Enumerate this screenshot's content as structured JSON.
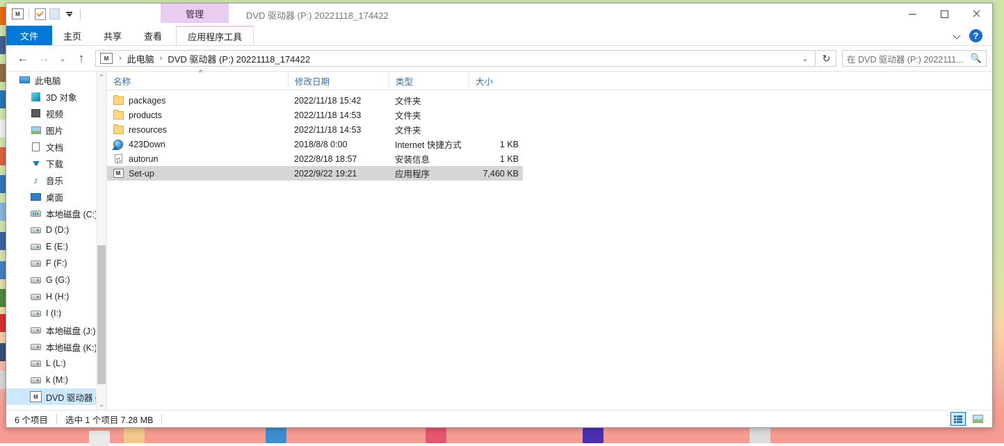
{
  "window": {
    "title": "DVD 驱动器 (P:) 20221118_174422",
    "contextual_tab_group": "管理",
    "controls": {
      "minimize": "minimize",
      "maximize": "maximize",
      "close": "close"
    }
  },
  "quick_access": {
    "items": [
      {
        "name": "app-icon",
        "glyph": "M"
      },
      {
        "name": "properties-icon",
        "glyph": ""
      },
      {
        "name": "new-folder-icon",
        "glyph": ""
      },
      {
        "name": "customize-qat-icon",
        "glyph": ""
      }
    ]
  },
  "ribbon": {
    "tabs": [
      {
        "id": "file",
        "label": "文件"
      },
      {
        "id": "home",
        "label": "主页"
      },
      {
        "id": "share",
        "label": "共享"
      },
      {
        "id": "view",
        "label": "查看"
      },
      {
        "id": "app-tools",
        "label": "应用程序工具"
      }
    ],
    "collapse_icon": "chevron-down-icon",
    "help_label": "?"
  },
  "address": {
    "back": "←",
    "forward": "→",
    "recent": "⌄",
    "up": "↑",
    "crumb_icon": "M",
    "crumbs": [
      "此电脑",
      "DVD 驱动器 (P:) 20221118_174422"
    ],
    "separator": "›",
    "dropdown": "⌄",
    "refresh": "↻"
  },
  "search": {
    "placeholder": "在 DVD 驱动器 (P:) 2022111...",
    "icon": "search-icon"
  },
  "sidebar": {
    "items": [
      {
        "label": "此电脑",
        "icon": "pc-icon",
        "level": "root",
        "selected": false
      },
      {
        "label": "3D 对象",
        "icon": "3d-icon",
        "level": "indent",
        "selected": false
      },
      {
        "label": "视频",
        "icon": "video-icon",
        "level": "indent",
        "selected": false
      },
      {
        "label": "图片",
        "icon": "picture-icon",
        "level": "indent",
        "selected": false
      },
      {
        "label": "文档",
        "icon": "document-icon",
        "level": "indent",
        "selected": false
      },
      {
        "label": "下载",
        "icon": "download-icon",
        "level": "indent",
        "selected": false
      },
      {
        "label": "音乐",
        "icon": "music-icon",
        "level": "indent",
        "selected": false
      },
      {
        "label": "桌面",
        "icon": "desktop-icon",
        "level": "indent",
        "selected": false
      },
      {
        "label": "本地磁盘 (C:)",
        "icon": "drive-system-icon",
        "level": "indent",
        "selected": false
      },
      {
        "label": "D (D:)",
        "icon": "drive-icon",
        "level": "indent",
        "selected": false
      },
      {
        "label": "E (E:)",
        "icon": "drive-icon",
        "level": "indent",
        "selected": false
      },
      {
        "label": "F (F:)",
        "icon": "drive-icon",
        "level": "indent",
        "selected": false
      },
      {
        "label": "G (G:)",
        "icon": "drive-icon",
        "level": "indent",
        "selected": false
      },
      {
        "label": "H (H:)",
        "icon": "drive-icon",
        "level": "indent",
        "selected": false
      },
      {
        "label": "I (I:)",
        "icon": "drive-icon",
        "level": "indent",
        "selected": false
      },
      {
        "label": "本地磁盘 (J:)",
        "icon": "drive-icon",
        "level": "indent",
        "selected": false
      },
      {
        "label": "本地磁盘 (K:)",
        "icon": "drive-icon",
        "level": "indent",
        "selected": false
      },
      {
        "label": "L (L:)",
        "icon": "drive-icon",
        "level": "indent",
        "selected": false
      },
      {
        "label": "k (M:)",
        "icon": "drive-icon",
        "level": "indent",
        "selected": false
      },
      {
        "label": "DVD 驱动器 (P:",
        "icon": "dvd-icon",
        "level": "indent",
        "selected": true
      }
    ],
    "scroll_up": "⌃",
    "scroll_down": "⌄"
  },
  "list": {
    "columns": [
      {
        "id": "name",
        "label": "名称"
      },
      {
        "id": "date",
        "label": "修改日期"
      },
      {
        "id": "type",
        "label": "类型"
      },
      {
        "id": "size",
        "label": "大小"
      }
    ],
    "sort_indicator": "^",
    "rows": [
      {
        "name": "packages",
        "date": "2022/11/18 15:42",
        "type": "文件夹",
        "size": "",
        "icon": "folder-icon",
        "selected": false
      },
      {
        "name": "products",
        "date": "2022/11/18 14:53",
        "type": "文件夹",
        "size": "",
        "icon": "folder-icon",
        "selected": false
      },
      {
        "name": "resources",
        "date": "2022/11/18 14:53",
        "type": "文件夹",
        "size": "",
        "icon": "folder-icon",
        "selected": false
      },
      {
        "name": "423Down",
        "date": "2018/8/8 0:00",
        "type": "Internet 快捷方式",
        "size": "1 KB",
        "icon": "url-icon",
        "selected": false
      },
      {
        "name": "autorun",
        "date": "2022/8/18 18:57",
        "type": "安装信息",
        "size": "1 KB",
        "icon": "inf-icon",
        "selected": false
      },
      {
        "name": "Set-up",
        "date": "2022/9/22 19:21",
        "type": "应用程序",
        "size": "7,460 KB",
        "icon": "exe-icon",
        "selected": true
      }
    ]
  },
  "status": {
    "item_count": "6 个项目",
    "selection": "选中 1 个项目  7.28 MB",
    "view_details": "details-view",
    "view_icons": "large-icons-view"
  },
  "colors": {
    "accent": "#0078d7",
    "contextual_tab": "#e9cdf0",
    "selection": "#d6d6d6",
    "nav_selection": "#cce8ff",
    "column_header_text": "#3c6ea0"
  }
}
